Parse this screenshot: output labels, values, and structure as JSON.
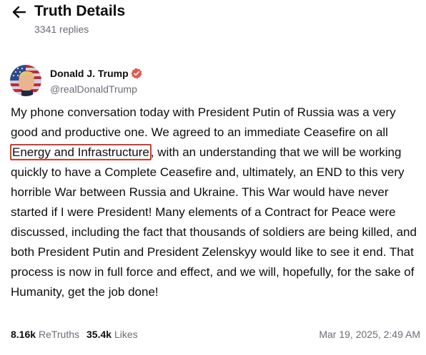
{
  "header": {
    "title": "Truth Details",
    "reply_count": "3341 replies",
    "back_icon": "arrow-left-icon"
  },
  "author": {
    "name": "Donald J. Trump",
    "handle": "@realDonaldTrump",
    "verified_icon": "verified-badge-icon",
    "verified_color": "#e4584c"
  },
  "post": {
    "text_before": "My phone conversation today with President Putin of Russia was a very good and productive one. We agreed to an immediate Ceasefire on all ",
    "highlighted_text": "Energy and Infrastructure",
    "text_after": ", with an understanding that we will be working quickly to have a Complete Ceasefire and, ultimately, an END to this very horrible War between Russia and Ukraine. This War would have never started if I were President! Many elements of a Contract for Peace were discussed, including the fact that thousands of soldiers are being killed, and both President Putin and President Zelenskyy would like to see it end. That process is now in full force and effect, and we will, hopefully, for the sake of Humanity, get the job done!",
    "highlight_color": "#d93a2b"
  },
  "stats": {
    "retruths_count": "8.16k",
    "retruths_label": "ReTruths",
    "likes_count": "35.4k",
    "likes_label": "Likes",
    "timestamp": "Mar 19, 2025, 2:49 AM"
  },
  "colors": {
    "text": "#0e0e10",
    "muted": "#6b6b76",
    "background": "#ffffff"
  }
}
